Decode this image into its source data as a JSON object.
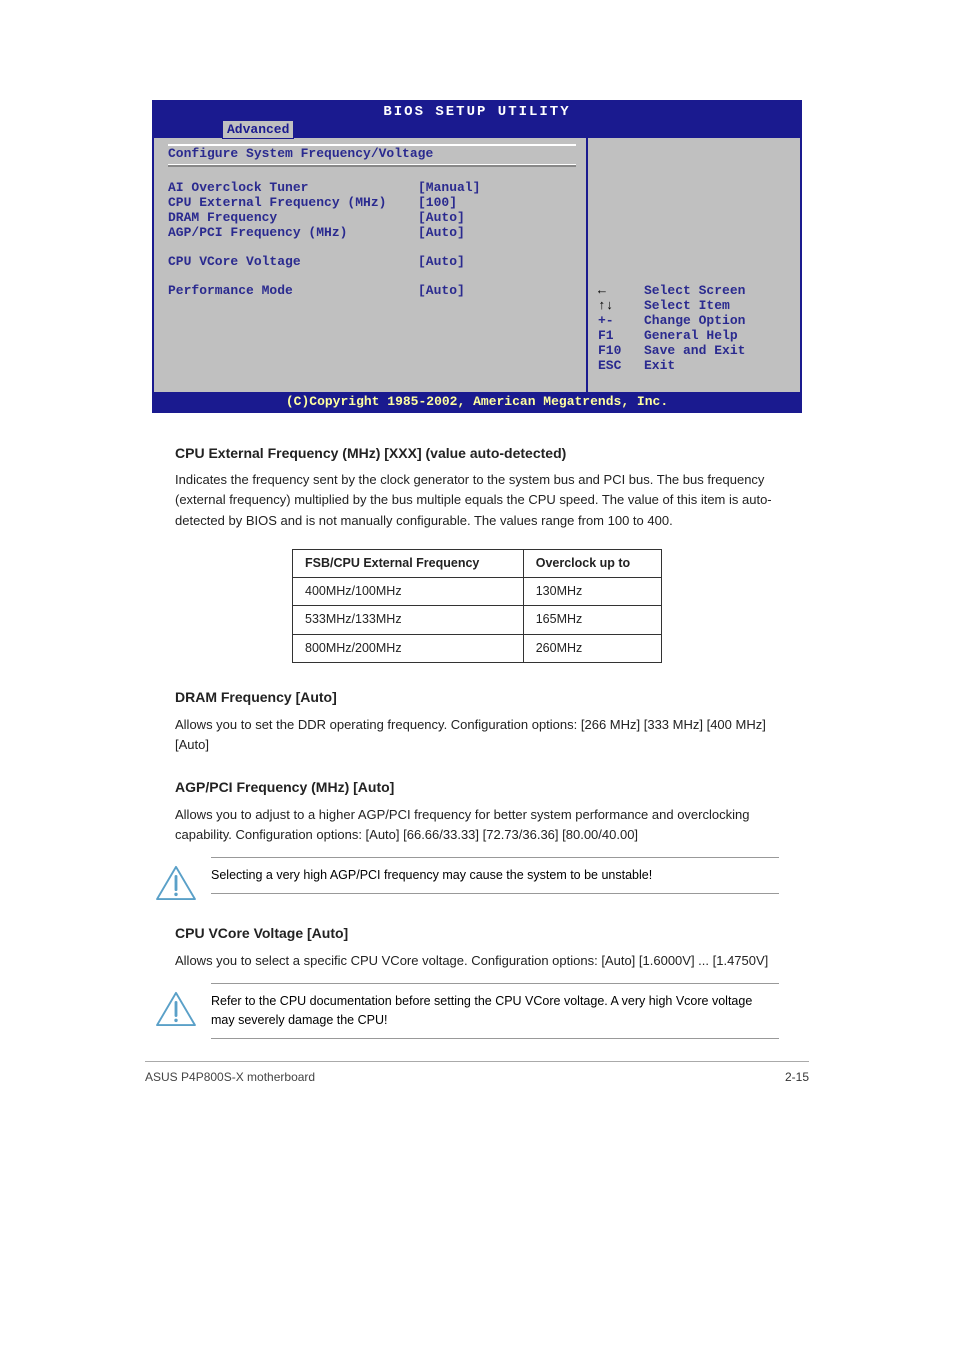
{
  "bios": {
    "title": "BIOS SETUP UTILITY",
    "tab": "Advanced",
    "section_title": "Configure System Frequency/Voltage",
    "rows": [
      {
        "label": "AI Overclock Tuner",
        "value": "[Manual]"
      },
      {
        "label": "CPU External Frequency (MHz)",
        "value": "[100]"
      },
      {
        "label": "DRAM Frequency",
        "value": "[Auto]"
      },
      {
        "label": "AGP/PCI Frequency (MHz)",
        "value": "[Auto]"
      }
    ],
    "rows2": [
      {
        "label": "CPU VCore Voltage",
        "value": "[Auto]"
      }
    ],
    "rows3": [
      {
        "label": "Performance Mode",
        "value": "[Auto]"
      }
    ],
    "help": [
      {
        "key_glyph": "arrow-left",
        "key": "",
        "desc": "Select Screen"
      },
      {
        "key_glyph": "arrow-updown",
        "key": "",
        "desc": "Select Item"
      },
      {
        "key_glyph": "",
        "key": "+-",
        "desc": "Change Option"
      },
      {
        "key_glyph": "",
        "key": "F1",
        "desc": "General Help"
      },
      {
        "key_glyph": "",
        "key": "F10",
        "desc": "Save and Exit"
      },
      {
        "key_glyph": "",
        "key": "ESC",
        "desc": "Exit"
      }
    ],
    "footer": "(C)Copyright 1985-2002, American Megatrends, Inc."
  },
  "content": {
    "cpu_ext_heading": "CPU External Frequency (MHz) [XXX] (value auto-detected)",
    "cpu_ext_p1": "Indicates the frequency sent by the clock generator to the system bus and PCI bus. The bus frequency (external frequency) multiplied by the bus multiple equals the CPU speed. The value of this item is auto-detected by BIOS and is not manually configurable. The values range from 100 to 400.",
    "dram_heading": "DRAM Frequency [Auto]",
    "dram_p1": "Allows you to set the DDR operating frequency. Configuration options: [266 MHz] [333 MHz] [400 MHz] [Auto]",
    "agp_heading": "AGP/PCI Frequency (MHz) [Auto]",
    "agp_p1": "Allows you to adjust to a higher AGP/PCI frequency for better system performance and overclocking capability. Configuration options: [Auto] [66.66/33.33] [72.73/36.36] [80.00/40.00]",
    "warn1": "Selecting a very high AGP/PCI frequency may cause the system to be unstable!",
    "vcore_heading": "CPU VCore Voltage [Auto]",
    "vcore_p1": "Allows you to select a specific CPU VCore voltage. Configuration options: [Auto] [1.6000V] ... [1.4750V]",
    "warn2": "Refer to the CPU documentation before setting the CPU VCore voltage. A very high Vcore voltage may severely damage the CPU!"
  },
  "freq_table": {
    "head": [
      "FSB/CPU External Frequency",
      "Overclock up to"
    ],
    "rows": [
      [
        "400MHz/100MHz",
        "130MHz"
      ],
      [
        "533MHz/133MHz",
        "165MHz"
      ],
      [
        "800MHz/200MHz",
        "260MHz"
      ]
    ]
  },
  "footer": {
    "left": "ASUS P4P800S-X motherboard",
    "right": "2-15"
  }
}
